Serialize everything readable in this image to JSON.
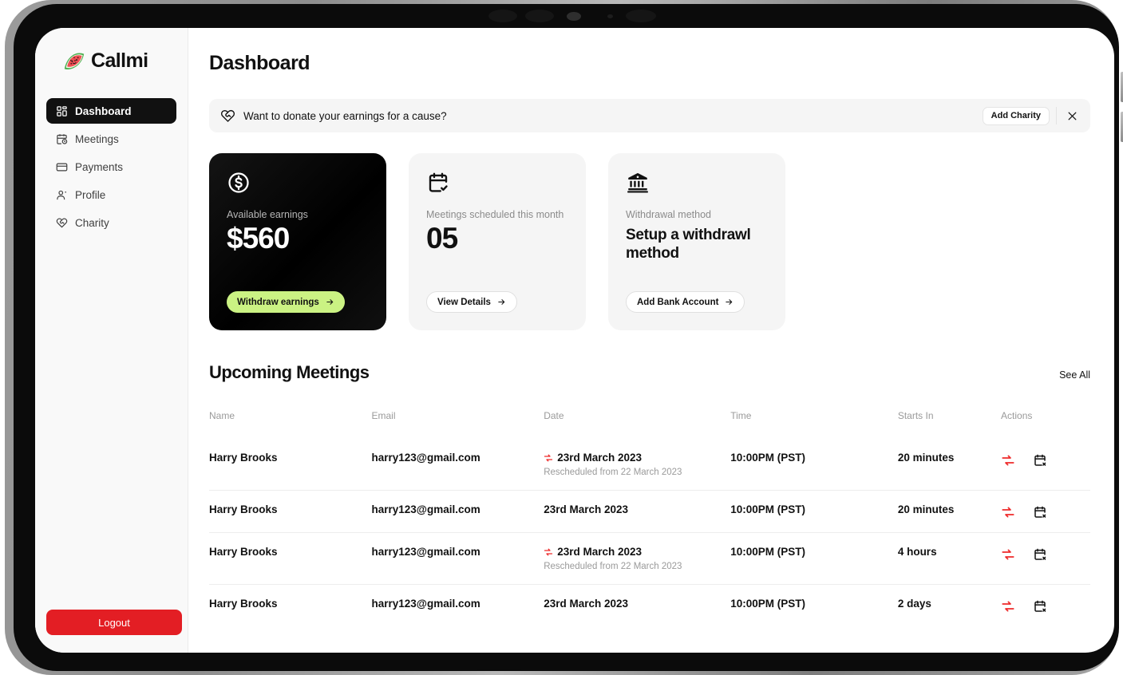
{
  "brand": {
    "name": "Callmi",
    "logo_icon": "watermelon-slice-icon"
  },
  "sidebar": {
    "items": [
      {
        "label": "Dashboard",
        "icon": "grid-icon",
        "active": true
      },
      {
        "label": "Meetings",
        "icon": "calendar-clock-icon",
        "active": false
      },
      {
        "label": "Payments",
        "icon": "credit-card-icon",
        "active": false
      },
      {
        "label": "Profile",
        "icon": "user-icon",
        "active": false
      },
      {
        "label": "Charity",
        "icon": "heart-handshake-icon",
        "active": false
      }
    ],
    "logout_label": "Logout"
  },
  "header": {
    "title": "Dashboard"
  },
  "banner": {
    "icon": "heart-handshake-icon",
    "text": "Want to donate your earnings for a cause?",
    "action_label": "Add Charity",
    "close_icon": "close-icon"
  },
  "cards": [
    {
      "icon": "dollar-coin-icon",
      "label": "Available earnings",
      "value": "$560",
      "button_label": "Withdraw earnings",
      "button_color": "#cbf283"
    },
    {
      "icon": "calendar-check-icon",
      "label": "Meetings scheduled this month",
      "value": "05",
      "button_label": "View Details"
    },
    {
      "icon": "bank-icon",
      "label": "Withdrawal method",
      "value": "Setup a withdrawl method",
      "button_label": "Add Bank Account"
    }
  ],
  "meetings": {
    "title": "Upcoming Meetings",
    "see_all_label": "See All",
    "columns": [
      "Name",
      "Email",
      "Date",
      "Time",
      "Starts In",
      "Actions"
    ],
    "rows": [
      {
        "name": "Harry Brooks",
        "email": "harry123@gmail.com",
        "date": "23rd March 2023",
        "rescheduled": true,
        "reschedule_note": "Rescheduled from 22 March 2023",
        "time": "10:00PM (PST)",
        "starts_in": "20 minutes",
        "actions": [
          "reschedule-icon",
          "cancel-meeting-icon"
        ]
      },
      {
        "name": "Harry Brooks",
        "email": "harry123@gmail.com",
        "date": "23rd March 2023",
        "rescheduled": false,
        "reschedule_note": "",
        "time": "10:00PM (PST)",
        "starts_in": "20 minutes",
        "actions": [
          "reschedule-icon",
          "cancel-meeting-icon"
        ]
      },
      {
        "name": "Harry Brooks",
        "email": "harry123@gmail.com",
        "date": "23rd March 2023",
        "rescheduled": true,
        "reschedule_note": "Rescheduled from 22 March 2023",
        "time": "10:00PM (PST)",
        "starts_in": "4 hours",
        "actions": [
          "reschedule-icon",
          "cancel-meeting-icon"
        ]
      },
      {
        "name": "Harry Brooks",
        "email": "harry123@gmail.com",
        "date": "23rd March 2023",
        "rescheduled": false,
        "reschedule_note": "",
        "time": "10:00PM (PST)",
        "starts_in": "2 days",
        "actions": [
          "reschedule-icon",
          "cancel-meeting-icon"
        ]
      }
    ]
  },
  "colors": {
    "accent_green": "#cbf283",
    "accent_red": "#e31e24",
    "reschedule_red": "#ee2a2a",
    "dark_card": "#000000",
    "muted_text": "#9a9a9a"
  }
}
